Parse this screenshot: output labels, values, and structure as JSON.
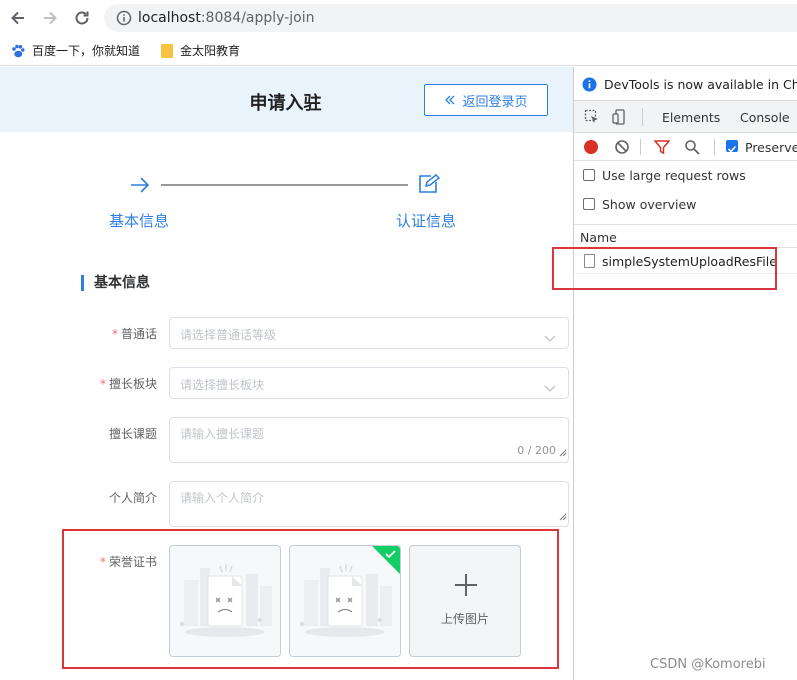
{
  "browser": {
    "url_host": "localhost",
    "url_port_path": ":8084/apply-join",
    "bookmarks": [
      {
        "label": "百度一下，你就知道"
      },
      {
        "label": "金太阳教育"
      }
    ]
  },
  "page": {
    "title": "申请入驻",
    "back_button": "返回登录页",
    "steps": [
      {
        "label": "基本信息"
      },
      {
        "label": "认证信息"
      }
    ],
    "section_title": "基本信息",
    "form": {
      "putonghua": {
        "label": "普通话",
        "placeholder": "请选择普通话等级",
        "required": true
      },
      "board": {
        "label": "擅长板块",
        "placeholder": "请选择擅长板块",
        "required": true
      },
      "topic": {
        "label": "擅长课题",
        "placeholder": "请输入擅长课题",
        "count": "0 / 200",
        "required": false
      },
      "intro": {
        "label": "个人简介",
        "placeholder": "请输入个人简介",
        "required": false
      },
      "honor": {
        "label": "荣誉证书",
        "required": true,
        "upload_text": "上传图片"
      }
    }
  },
  "devtools": {
    "banner": "DevTools is now available in Chinese",
    "tabs": [
      {
        "label": "Elements"
      },
      {
        "label": "Console"
      }
    ],
    "preserve_label": "Preserve log",
    "options": [
      {
        "label": "Use large request rows"
      },
      {
        "label": "Show overview"
      }
    ],
    "column_name": "Name",
    "request_name": "simpleSystemUploadResFile"
  },
  "watermark": "CSDN @Komorebi",
  "colors": {
    "accent": "#2f7fe0",
    "header_bg": "#e8f3fc",
    "required": "#f56c6c",
    "highlight_box": "#d9363e",
    "success": "#13ce66"
  }
}
